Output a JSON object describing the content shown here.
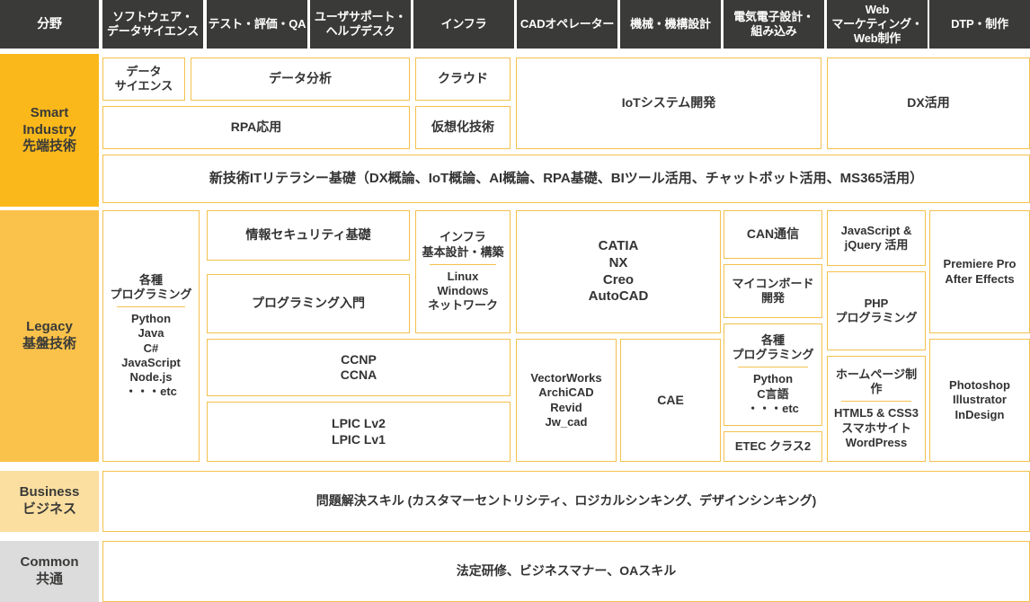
{
  "headers": [
    "分野",
    "ソフトウェア・\nデータサイエンス",
    "テスト・評価・QA",
    "ユーザサポート・\nヘルプデスク",
    "インフラ",
    "CADオペレーター",
    "機械・機構設計",
    "電気電子設計・\n組み込み",
    "Web\nマーケティング・\nWeb制作",
    "DTP・制作"
  ],
  "categories": {
    "smart": "Smart\nIndustry\n先端技術",
    "legacy": "Legacy\n基盤技術",
    "business": "Business\nビジネス",
    "common": "Common\n共通"
  },
  "smart_industry": {
    "data_science": "データ\nサイエンス",
    "data_analysis": "データ分析",
    "cloud": "クラウド",
    "rpa": "RPA応用",
    "virtualization": "仮想化技術",
    "iot": "IoTシステム開発",
    "dx": "DX活用",
    "literacy": "新技術ITリテラシー基礎（DX概論、IoT概論、AI概論、RPA基礎、BIツール活用、チャットボット活用、MS365活用）"
  },
  "legacy": {
    "programming_head": "各種\nプログラミング",
    "programming_list": "Python\nJava\nC#\nJavaScript\nNode.js\n・・・etc",
    "security": "情報セキュリティ基礎",
    "programming_intro": "プログラミング入門",
    "ccnp": "CCNP\nCCNA",
    "lpic": "LPIC Lv2\nLPIC Lv1",
    "infra_head": "インフラ\n基本設計・構築",
    "infra_list": "Linux\nWindows\nネットワーク",
    "cad_main": "CATIA\nNX\nCreo\nAutoCAD",
    "vectorworks": "VectorWorks\nArchiCAD\nRevid\nJw_cad",
    "cae": "CAE",
    "can": "CAN通信",
    "mcu": "マイコンボード\n開発",
    "ee_programming_head": "各種\nプログラミング",
    "ee_programming_list": "Python\nC言語\n・・・etc",
    "etec": "ETEC クラス2",
    "js_jquery": "JavaScript &\njQuery 活用",
    "php": "PHP\nプログラミング",
    "homepage_head": "ホームページ制作",
    "homepage_list": "HTML5 & CSS3\nスマホサイト\nWordPress",
    "premiere": "Premiere Pro\nAfter Effects",
    "photoshop": "Photoshop\nIllustrator\nInDesign"
  },
  "business": {
    "row": "問題解決スキル (カスタマーセントリシティ、ロジカルシンキング、デザインシンキング)"
  },
  "common": {
    "row": "法定研修、ビジネスマナー、OAスキル"
  },
  "colors": {
    "header_bg": "#3a3a38",
    "smart_bg": "#FAB81B",
    "legacy_bg": "#FAC24A",
    "business_bg": "#FBDFA0",
    "common_bg": "#DCDCDC",
    "box_border": "#F3C14E",
    "text": "#333333"
  }
}
